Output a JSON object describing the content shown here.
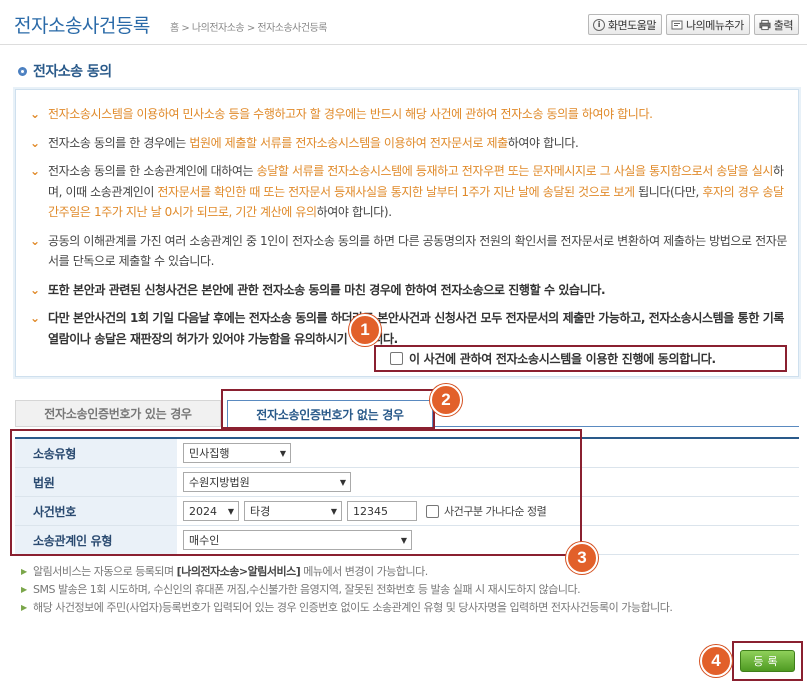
{
  "header": {
    "title": "전자소송사건등록",
    "breadcrumb": "홈 > 나의전자소송 > 전자소송사건등록",
    "buttons": {
      "help": "화면도움말",
      "my_menu": "나의메뉴추가",
      "print": "출력"
    }
  },
  "section_title": "전자소송 동의",
  "notice": {
    "item1": "전자소송시스템을 이용하여 민사소송 등을 수행하고자 할 경우에는 반드시 해당 사건에 관하여 전자소송 동의를 하여야 합니다.",
    "item2_pre": "전자소송 동의를 한 경우에는 ",
    "item2_hl": "법원에 제출할 서류를 전자소송시스템을 이용하여 전자문서로 제출",
    "item2_post": "하여야 합니다.",
    "item3_a": "전자소송 동의를 한 소송관계인에 대하여는 ",
    "item3_b": "송달할 서류를 전자소송시스템에 등재하고 전자우편 또는 문자메시지로 그 사실을 통지함으로서 송달을 실시",
    "item3_c": "하며, 이때 소송관계인이 ",
    "item3_d": "전자문서를 확인한 때 또는 전자문서 등재사실을 통지한 날부터 1주가 지난 날에 송달된 것으로 보게",
    "item3_e": " 됩니다(다만, ",
    "item3_f": "후자의 경우 송달간주일은 1주가 지난 날 0시가 되므로, 기간 계산에 유의",
    "item3_g": "하여야 합니다).",
    "item4": "공동의 이해관계를 가진 여러 소송관계인 중 1인이 전자소송 동의를 하면 다른 공동명의자 전원의 확인서를 전자문서로 변환하여 제출하는 방법으로 전자문서를 단독으로 제출할 수 있습니다.",
    "item5": "또한 본안과 관련된 신청사건은 본안에 관한 전자소송 동의를 마친 경우에 한하여 전자소송으로 진행할 수 있습니다.",
    "item6": "다만 본안사건의 1회 기일 다음날 후에는 전자소송 동의를 하더라도 본안사건과 신청사건 모두 전자문서의 제출만 가능하고, 전자소송시스템을 통한 기록열람이나 송달은 재판장의 허가가 있어야 가능함을 유의하시기 바랍니다.",
    "agree_label": "이 사건에 관하여 전자소송시스템을 이용한 진행에 동의합니다."
  },
  "tabs": {
    "with_cert": "전자소송인증번호가 있는 경우",
    "without_cert": "전자소송인증번호가 없는 경우"
  },
  "form": {
    "case_type_label": "소송유형",
    "case_type_value": "민사집행",
    "court_label": "법원",
    "court_value": "수원지방법원",
    "case_no_label": "사건번호",
    "case_year": "2024",
    "case_code": "타경",
    "case_number": "12345",
    "sort_label": "사건구분 가나다순 정렬",
    "party_label": "소송관계인 유형",
    "party_value": "매수인"
  },
  "help": {
    "line1_pre": "알림서비스는 자동으로 등록되며 ",
    "line1_strong": "[나의전자소송>알림서비스]",
    "line1_post": " 메뉴에서 변경이 가능합니다.",
    "line2": "SMS 발송은 1회 시도하며, 수신인의 휴대폰 꺼짐,수신불가한 음영지역, 잘못된 전화번호 등 발송 실패 시 재시도하지 않습니다.",
    "line3": "해당 사건정보에 주민(사업자)등록번호가 입력되어 있는 경우 인증번호 없이도 소송관계인 유형 및 당사자명을 입력하면 전자사건등록이 가능합니다."
  },
  "register_button": "등록",
  "badges": [
    "1",
    "2",
    "3",
    "4"
  ],
  "colors": {
    "accent": "#2a5a8a",
    "notice": "#e08a2a",
    "highlight_box": "#8a2030",
    "badge": "#e2602a",
    "register": "#4e9a22"
  }
}
